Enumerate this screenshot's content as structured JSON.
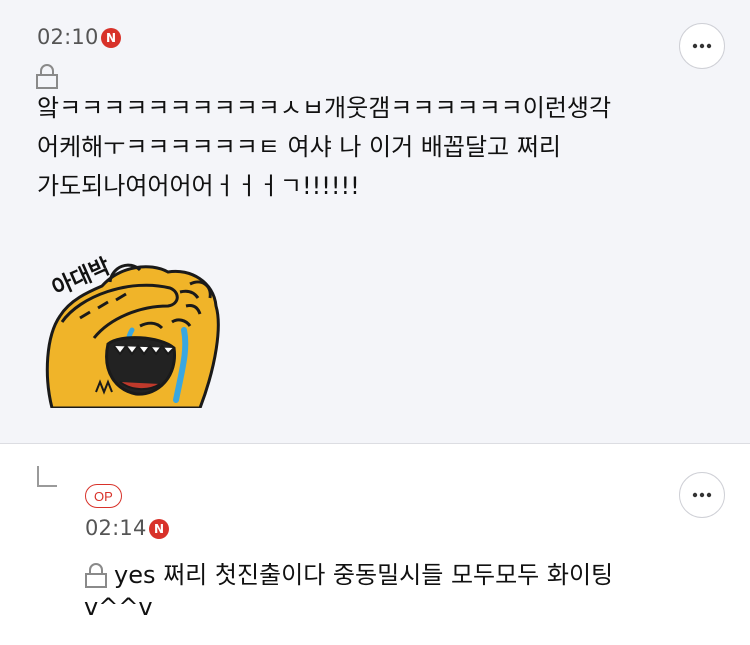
{
  "comments": [
    {
      "time": "02:10",
      "badge": "N",
      "lines": [
        "앜ㅋㅋㅋㅋㅋㅋㅋㅋㅋㅋㅅㅂ개웃갬ㅋㅋㅋㅋㅋㅋ이런생각",
        "어케해ㅜㅋㅋㅋㅋㅋㅋㅌ 여샤 나 이거 배꼽달고 쩌리",
        "가도되나여어어어ㅓㅓㅓㄱ!!!!!!"
      ],
      "sticker": {
        "caption": "아대박",
        "icon": "crying-laughing-tiger-sticker"
      }
    },
    {
      "op_label": "OP",
      "time": "02:14",
      "badge": "N",
      "lines": [
        "yes 쩌리 첫진출이다 중동밀시들 모두모두 화이팅",
        "v^^v"
      ]
    }
  ],
  "colors": {
    "accent_red": "#d8322a",
    "main_bg": "#f4f5f9",
    "sticker_yellow": "#f0b429"
  }
}
